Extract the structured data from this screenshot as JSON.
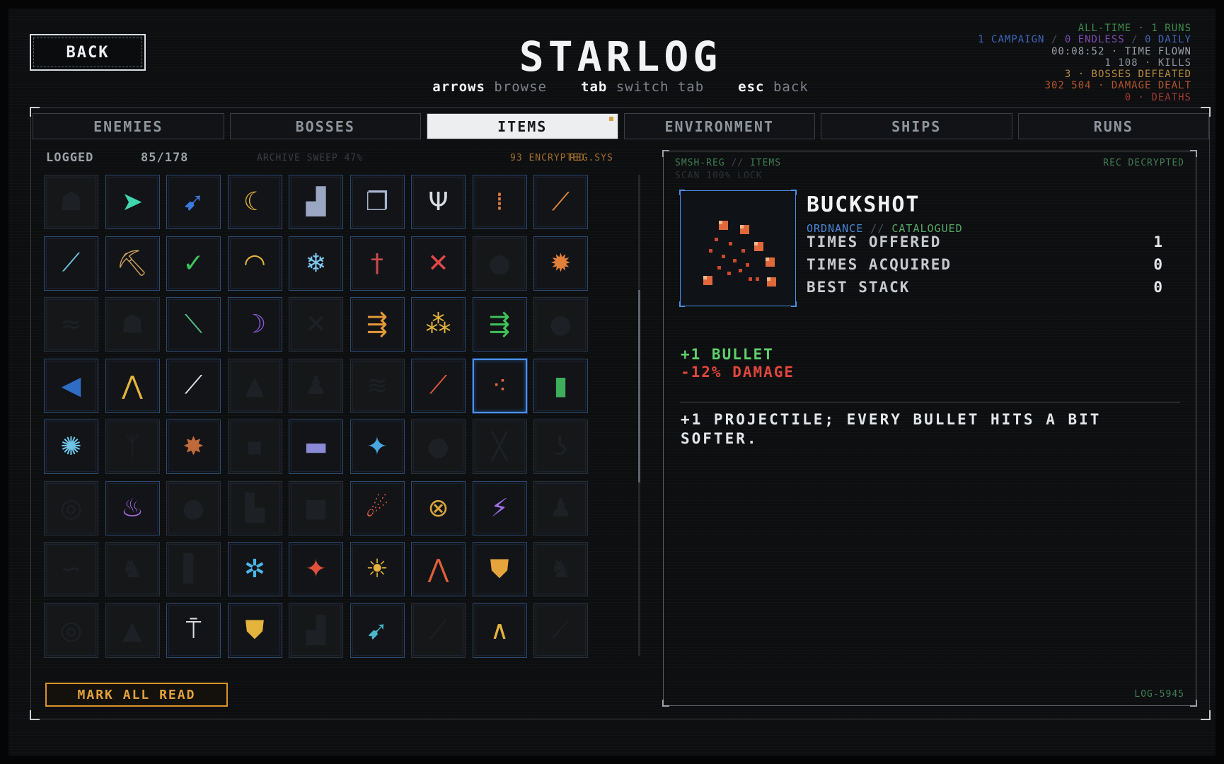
{
  "header": {
    "back_label": "BACK",
    "title": "STARLOG",
    "hints": [
      {
        "key": "arrows",
        "desc": "browse"
      },
      {
        "key": "tab",
        "desc": "switch tab"
      },
      {
        "key": "esc",
        "desc": "back"
      }
    ]
  },
  "alltime": {
    "runs": "ALL-TIME · 1 RUNS",
    "campaign": "1 CAMPAIGN",
    "endless": "0 ENDLESS",
    "daily": "0 DAILY",
    "time": "00:08:52 · TIME FLOWN",
    "kills": "1 108 · KILLS",
    "bosses": "3 · BOSSES DEFEATED",
    "damage": "302 504 · DAMAGE DEALT",
    "deaths": "0 · DEATHS"
  },
  "tabs": [
    {
      "label": "ENEMIES",
      "active": false
    },
    {
      "label": "BOSSES",
      "active": false
    },
    {
      "label": "ITEMS",
      "active": true
    },
    {
      "label": "ENVIRONMENT",
      "active": false
    },
    {
      "label": "SHIPS",
      "active": false
    },
    {
      "label": "RUNS",
      "active": false
    }
  ],
  "list": {
    "logged_label": "LOGGED",
    "logged_count": "85/178",
    "sweep": "ARCHIVE SWEEP 47%",
    "encrypted": "93 ENCRYPTED",
    "reg": "REG.SYS",
    "mark_all_label": "MARK ALL READ",
    "scroll_fraction": 0.4
  },
  "items": [
    {
      "icon": "cloak-icon",
      "glyph": "☗",
      "color": "#1e2126",
      "locked": true
    },
    {
      "icon": "arrow-icon",
      "glyph": "➤",
      "color": "#3fd6b0",
      "locked": false
    },
    {
      "icon": "drill-icon",
      "glyph": "➹",
      "color": "#3c7ae0",
      "locked": false
    },
    {
      "icon": "moon-icon",
      "glyph": "☾",
      "color": "#e5b43c",
      "locked": false
    },
    {
      "icon": "cityscape-icon",
      "glyph": "▟",
      "color": "#9aa6c2",
      "locked": false
    },
    {
      "icon": "stacked-blocks-icon",
      "glyph": "❐",
      "color": "#a7b5cf",
      "locked": false
    },
    {
      "icon": "fork-icon",
      "glyph": "Ψ",
      "color": "#d9dde2",
      "locked": false
    },
    {
      "icon": "candles-icon",
      "glyph": "⁞",
      "color": "#e07a3a",
      "locked": false
    },
    {
      "icon": "feather-icon",
      "glyph": "⟋",
      "color": "#e0893a",
      "locked": false
    },
    {
      "icon": "needle-icon",
      "glyph": "⟋",
      "color": "#6ec3e6",
      "locked": false
    },
    {
      "icon": "pickaxe-icon",
      "glyph": "⛏",
      "color": "#d0a05a",
      "locked": false
    },
    {
      "icon": "check-ring-icon",
      "glyph": "✓",
      "color": "#3fc25a",
      "locked": false
    },
    {
      "icon": "dome-icon",
      "glyph": "◠",
      "color": "#e5b43c",
      "locked": false
    },
    {
      "icon": "snowflake-icon",
      "glyph": "❄",
      "color": "#7ec8f0",
      "locked": false
    },
    {
      "icon": "dagger-icon",
      "glyph": "†",
      "color": "#c94a4a",
      "locked": false
    },
    {
      "icon": "cross-icon",
      "glyph": "✕",
      "color": "#e04848",
      "locked": false
    },
    {
      "icon": "blob-icon",
      "glyph": "●",
      "color": "#1e2126",
      "locked": true
    },
    {
      "icon": "spider-icon",
      "glyph": "✹",
      "color": "#e0803a",
      "locked": false
    },
    {
      "icon": "waves-icon",
      "glyph": "≈",
      "color": "#1e2126",
      "locked": true
    },
    {
      "icon": "ghost-icon",
      "glyph": "☗",
      "color": "#1e2126",
      "locked": true
    },
    {
      "icon": "rod-icon",
      "glyph": "⟍",
      "color": "#55c290",
      "locked": false
    },
    {
      "icon": "crescent-blade-icon",
      "glyph": "☽",
      "color": "#8a5ad6",
      "locked": false
    },
    {
      "icon": "windmill-icon",
      "glyph": "✕",
      "color": "#1e2126",
      "locked": true
    },
    {
      "icon": "triple-arrow-icon",
      "glyph": "⇶",
      "color": "#e5983a",
      "locked": false
    },
    {
      "icon": "sparkles-icon",
      "glyph": "⁂",
      "color": "#e5b43c",
      "locked": false
    },
    {
      "icon": "triple-green-arrow-icon",
      "glyph": "⇶",
      "color": "#3fc25a",
      "locked": false
    },
    {
      "icon": "rock-icon",
      "glyph": "●",
      "color": "#1e2126",
      "locked": true
    },
    {
      "icon": "fish-icon",
      "glyph": "◀",
      "color": "#2f6cc4",
      "locked": false
    },
    {
      "icon": "pick-icon",
      "glyph": "⋀",
      "color": "#e5b43c",
      "locked": false
    },
    {
      "icon": "sword-icon",
      "glyph": "⟋",
      "color": "#dfe3e8",
      "locked": false
    },
    {
      "icon": "flask-icon",
      "glyph": "▲",
      "color": "#1e2126",
      "locked": true
    },
    {
      "icon": "statue-icon",
      "glyph": "♟",
      "color": "#1e2126",
      "locked": true
    },
    {
      "icon": "claw-icon",
      "glyph": "≋",
      "color": "#1e2126",
      "locked": true
    },
    {
      "icon": "torch-icon",
      "glyph": "⟋",
      "color": "#e05a3a",
      "locked": false
    },
    {
      "icon": "buckshot-icon",
      "glyph": "⁖",
      "color": "#e0683a",
      "locked": false,
      "selected": true
    },
    {
      "icon": "canister-icon",
      "glyph": "▮",
      "color": "#3fae5a",
      "locked": false
    },
    {
      "icon": "gear-orb-icon",
      "glyph": "✺",
      "color": "#6ec3e6",
      "locked": false
    },
    {
      "icon": "tree-icon",
      "glyph": "ᛉ",
      "color": "#1e2126",
      "locked": true
    },
    {
      "icon": "bomb-icon",
      "glyph": "✸",
      "color": "#c06a3a",
      "locked": false
    },
    {
      "icon": "jar-icon",
      "glyph": "▪",
      "color": "#1e2126",
      "locked": true
    },
    {
      "icon": "battery-icon",
      "glyph": "▬",
      "color": "#8a8ad6",
      "locked": false
    },
    {
      "icon": "satellite-icon",
      "glyph": "✦",
      "color": "#4aa6e0",
      "locked": false
    },
    {
      "icon": "stone-icon",
      "glyph": "●",
      "color": "#1e2126",
      "locked": true
    },
    {
      "icon": "crossed-lines-icon",
      "glyph": "╳",
      "color": "#1e2126",
      "locked": true
    },
    {
      "icon": "hook-icon",
      "glyph": "ʖ",
      "color": "#1e2126",
      "locked": true
    },
    {
      "icon": "eye-icon",
      "glyph": "◎",
      "color": "#1e2126",
      "locked": true
    },
    {
      "icon": "cauldron-icon",
      "glyph": "♨",
      "color": "#a86ae0",
      "locked": false
    },
    {
      "icon": "boulder-icon",
      "glyph": "●",
      "color": "#1e2126",
      "locked": true
    },
    {
      "icon": "turret-icon",
      "glyph": "▙",
      "color": "#1e2126",
      "locked": true
    },
    {
      "icon": "chunk-icon",
      "glyph": "■",
      "color": "#1e2126",
      "locked": true
    },
    {
      "icon": "comet-icon",
      "glyph": "☄",
      "color": "#e0603a",
      "locked": false
    },
    {
      "icon": "atom-icon",
      "glyph": "⊗",
      "color": "#d6a53c",
      "locked": false
    },
    {
      "icon": "lightning-icon",
      "glyph": "⚡",
      "color": "#a070e8",
      "locked": false
    },
    {
      "icon": "figure-icon",
      "glyph": "♟",
      "color": "#1e2126",
      "locked": true
    },
    {
      "icon": "snake-icon",
      "glyph": "∽",
      "color": "#1e2126",
      "locked": true
    },
    {
      "icon": "gargoyle-icon",
      "glyph": "♞",
      "color": "#1e2126",
      "locked": true
    },
    {
      "icon": "monolith-icon",
      "glyph": "▌",
      "color": "#1e2126",
      "locked": true
    },
    {
      "icon": "vortex-icon",
      "glyph": "✲",
      "color": "#4ab6e8",
      "locked": false
    },
    {
      "icon": "star-burst-icon",
      "glyph": "✦",
      "color": "#e0503a",
      "locked": false
    },
    {
      "icon": "sun-icon",
      "glyph": "☀",
      "color": "#e5b43c",
      "locked": false
    },
    {
      "icon": "chevron-stack-icon",
      "glyph": "⋀",
      "color": "#e0603a",
      "locked": false
    },
    {
      "icon": "shell-icon",
      "glyph": "⛊",
      "color": "#e5a43c",
      "locked": false
    },
    {
      "icon": "beast-icon",
      "glyph": "♞",
      "color": "#1e2126",
      "locked": true
    },
    {
      "icon": "orb-icon",
      "glyph": "◎",
      "color": "#1e2126",
      "locked": true
    },
    {
      "icon": "pine-icon",
      "glyph": "▲",
      "color": "#1e2126",
      "locked": true
    },
    {
      "icon": "lamp-post-icon",
      "glyph": "⍑",
      "color": "#d9dde2",
      "locked": false
    },
    {
      "icon": "lantern-icon",
      "glyph": "⛊",
      "color": "#e5b43c",
      "locked": false
    },
    {
      "icon": "cannon-icon",
      "glyph": "▟",
      "color": "#1e2126",
      "locked": true
    },
    {
      "icon": "bird-icon",
      "glyph": "➹",
      "color": "#4ab6c8",
      "locked": false
    },
    {
      "icon": "scythe-icon",
      "glyph": "⟋",
      "color": "#1e2126",
      "locked": true
    },
    {
      "icon": "legs-icon",
      "glyph": "∧",
      "color": "#e5b43c",
      "locked": false
    },
    {
      "icon": "leaf-icon",
      "glyph": "⟋",
      "color": "#1e2126",
      "locked": true
    }
  ],
  "detail": {
    "registry": "SMSH-REG",
    "registry_sep": "//",
    "registry_section": "ITEMS",
    "status": "REC DECRYPTED",
    "scan": "SCAN 100% LOCK",
    "name": "BUCKSHOT",
    "category": "ORDNANCE",
    "category_sep": "//",
    "catalogued": "CATALOGUED",
    "stats": [
      {
        "label": "TIMES OFFERED",
        "value": "1"
      },
      {
        "label": "TIMES ACQUIRED",
        "value": "0"
      },
      {
        "label": "BEST STACK",
        "value": "0"
      }
    ],
    "buff": "+1 BULLET",
    "nerf": "-12% DAMAGE",
    "description": "+1 PROJECTILE; EVERY BULLET HITS A BIT SOFTER.",
    "log_id": "LOG-5945",
    "accent_color": "#e0683a"
  }
}
